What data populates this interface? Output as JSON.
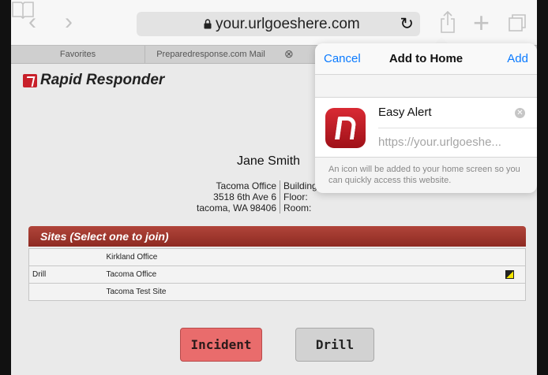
{
  "browser": {
    "url": "your.urlgoeshere.com",
    "tabs": [
      "Favorites",
      "Preparedresponse.com Mail"
    ]
  },
  "page": {
    "logo_text": "Rapid Responder",
    "person_name": "Jane Smith",
    "address": {
      "line1": "Tacoma Office",
      "line2": "3518 6th Ave 6",
      "line3": "tacoma, WA 98406"
    },
    "building_labels": {
      "building": "Building",
      "floor": "Floor:",
      "room": "Room:"
    },
    "sites_header": "Sites (Select one to join)",
    "sites": [
      {
        "status": "",
        "name": "Kirkland Office",
        "flag": false
      },
      {
        "status": "Drill",
        "name": "Tacoma Office",
        "flag": true
      },
      {
        "status": "",
        "name": "Tacoma Test Site",
        "flag": false
      }
    ],
    "incident_button": "Incident",
    "drill_button": "Drill"
  },
  "popover": {
    "cancel": "Cancel",
    "title": "Add to Home",
    "add": "Add",
    "app_name": "Easy Alert",
    "app_url": "https://your.urlgoeshe...",
    "note": "An icon will be added to your home screen so you can quickly access this website."
  },
  "colors": {
    "accent_blue": "#0a7aff",
    "brand_red": "#c8202a",
    "sites_header": "#9e3328",
    "incident": "#e96c6c"
  }
}
